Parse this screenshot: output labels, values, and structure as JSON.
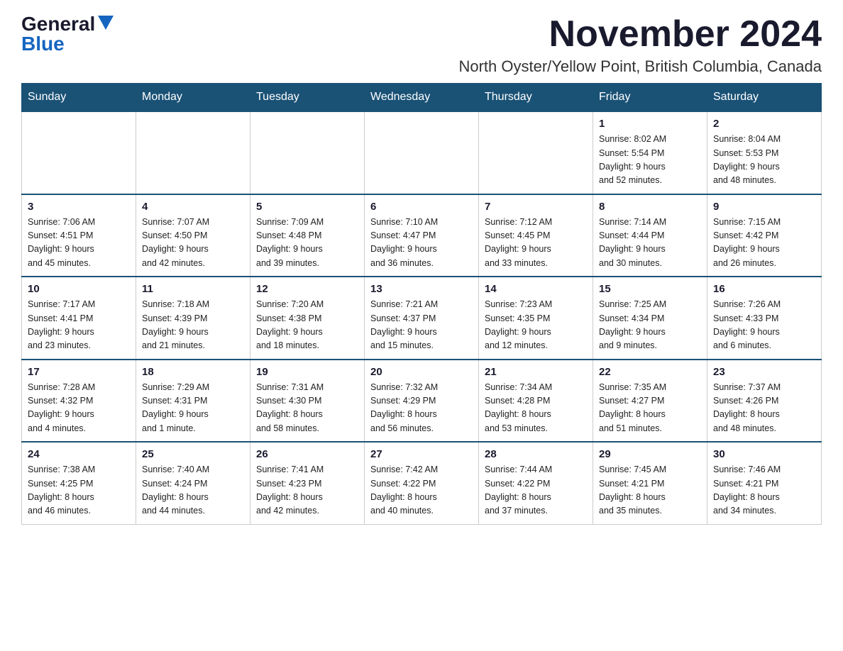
{
  "logo": {
    "general": "General",
    "blue": "Blue"
  },
  "title": "November 2024",
  "location": "North Oyster/Yellow Point, British Columbia, Canada",
  "days_of_week": [
    "Sunday",
    "Monday",
    "Tuesday",
    "Wednesday",
    "Thursday",
    "Friday",
    "Saturday"
  ],
  "weeks": [
    [
      {
        "day": "",
        "info": ""
      },
      {
        "day": "",
        "info": ""
      },
      {
        "day": "",
        "info": ""
      },
      {
        "day": "",
        "info": ""
      },
      {
        "day": "",
        "info": ""
      },
      {
        "day": "1",
        "info": "Sunrise: 8:02 AM\nSunset: 5:54 PM\nDaylight: 9 hours\nand 52 minutes."
      },
      {
        "day": "2",
        "info": "Sunrise: 8:04 AM\nSunset: 5:53 PM\nDaylight: 9 hours\nand 48 minutes."
      }
    ],
    [
      {
        "day": "3",
        "info": "Sunrise: 7:06 AM\nSunset: 4:51 PM\nDaylight: 9 hours\nand 45 minutes."
      },
      {
        "day": "4",
        "info": "Sunrise: 7:07 AM\nSunset: 4:50 PM\nDaylight: 9 hours\nand 42 minutes."
      },
      {
        "day": "5",
        "info": "Sunrise: 7:09 AM\nSunset: 4:48 PM\nDaylight: 9 hours\nand 39 minutes."
      },
      {
        "day": "6",
        "info": "Sunrise: 7:10 AM\nSunset: 4:47 PM\nDaylight: 9 hours\nand 36 minutes."
      },
      {
        "day": "7",
        "info": "Sunrise: 7:12 AM\nSunset: 4:45 PM\nDaylight: 9 hours\nand 33 minutes."
      },
      {
        "day": "8",
        "info": "Sunrise: 7:14 AM\nSunset: 4:44 PM\nDaylight: 9 hours\nand 30 minutes."
      },
      {
        "day": "9",
        "info": "Sunrise: 7:15 AM\nSunset: 4:42 PM\nDaylight: 9 hours\nand 26 minutes."
      }
    ],
    [
      {
        "day": "10",
        "info": "Sunrise: 7:17 AM\nSunset: 4:41 PM\nDaylight: 9 hours\nand 23 minutes."
      },
      {
        "day": "11",
        "info": "Sunrise: 7:18 AM\nSunset: 4:39 PM\nDaylight: 9 hours\nand 21 minutes."
      },
      {
        "day": "12",
        "info": "Sunrise: 7:20 AM\nSunset: 4:38 PM\nDaylight: 9 hours\nand 18 minutes."
      },
      {
        "day": "13",
        "info": "Sunrise: 7:21 AM\nSunset: 4:37 PM\nDaylight: 9 hours\nand 15 minutes."
      },
      {
        "day": "14",
        "info": "Sunrise: 7:23 AM\nSunset: 4:35 PM\nDaylight: 9 hours\nand 12 minutes."
      },
      {
        "day": "15",
        "info": "Sunrise: 7:25 AM\nSunset: 4:34 PM\nDaylight: 9 hours\nand 9 minutes."
      },
      {
        "day": "16",
        "info": "Sunrise: 7:26 AM\nSunset: 4:33 PM\nDaylight: 9 hours\nand 6 minutes."
      }
    ],
    [
      {
        "day": "17",
        "info": "Sunrise: 7:28 AM\nSunset: 4:32 PM\nDaylight: 9 hours\nand 4 minutes."
      },
      {
        "day": "18",
        "info": "Sunrise: 7:29 AM\nSunset: 4:31 PM\nDaylight: 9 hours\nand 1 minute."
      },
      {
        "day": "19",
        "info": "Sunrise: 7:31 AM\nSunset: 4:30 PM\nDaylight: 8 hours\nand 58 minutes."
      },
      {
        "day": "20",
        "info": "Sunrise: 7:32 AM\nSunset: 4:29 PM\nDaylight: 8 hours\nand 56 minutes."
      },
      {
        "day": "21",
        "info": "Sunrise: 7:34 AM\nSunset: 4:28 PM\nDaylight: 8 hours\nand 53 minutes."
      },
      {
        "day": "22",
        "info": "Sunrise: 7:35 AM\nSunset: 4:27 PM\nDaylight: 8 hours\nand 51 minutes."
      },
      {
        "day": "23",
        "info": "Sunrise: 7:37 AM\nSunset: 4:26 PM\nDaylight: 8 hours\nand 48 minutes."
      }
    ],
    [
      {
        "day": "24",
        "info": "Sunrise: 7:38 AM\nSunset: 4:25 PM\nDaylight: 8 hours\nand 46 minutes."
      },
      {
        "day": "25",
        "info": "Sunrise: 7:40 AM\nSunset: 4:24 PM\nDaylight: 8 hours\nand 44 minutes."
      },
      {
        "day": "26",
        "info": "Sunrise: 7:41 AM\nSunset: 4:23 PM\nDaylight: 8 hours\nand 42 minutes."
      },
      {
        "day": "27",
        "info": "Sunrise: 7:42 AM\nSunset: 4:22 PM\nDaylight: 8 hours\nand 40 minutes."
      },
      {
        "day": "28",
        "info": "Sunrise: 7:44 AM\nSunset: 4:22 PM\nDaylight: 8 hours\nand 37 minutes."
      },
      {
        "day": "29",
        "info": "Sunrise: 7:45 AM\nSunset: 4:21 PM\nDaylight: 8 hours\nand 35 minutes."
      },
      {
        "day": "30",
        "info": "Sunrise: 7:46 AM\nSunset: 4:21 PM\nDaylight: 8 hours\nand 34 minutes."
      }
    ]
  ]
}
